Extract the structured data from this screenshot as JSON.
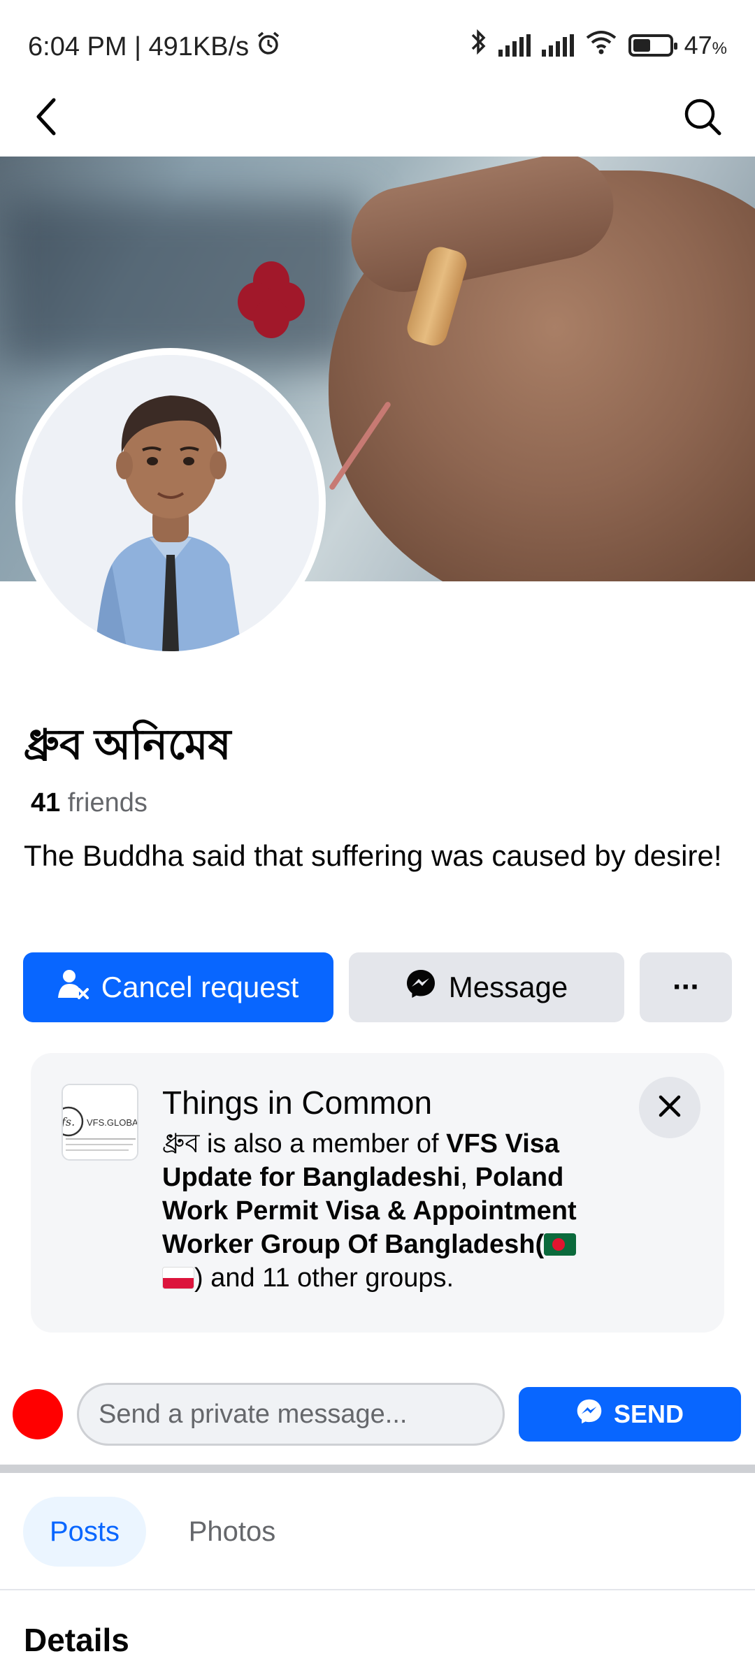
{
  "status_bar": {
    "time_speed": "6:04 PM | 491KB/s",
    "battery": "47",
    "battery_unit": "%",
    "battery_level": 0.47
  },
  "profile": {
    "name": "ধ্রুব অনিমেষ",
    "friends_count": "41",
    "friends_label": "friends",
    "bio": "The Buddha said that suffering was caused by desire!"
  },
  "actions": {
    "cancel_request_label": "Cancel request",
    "message_label": "Message",
    "more_label": "···"
  },
  "common": {
    "title": "Things in Common",
    "thumb_text": "VFS.GLOBAL",
    "prefix": "ধ্রুব is also a member of ",
    "group1": "VFS Visa Update for Bangladeshi",
    "sep": ", ",
    "group2": "Poland Work Permit Visa & Appointment Worker Group Of Bangladesh(",
    "suffix": ") and 11 other groups."
  },
  "private_message": {
    "placeholder": "Send a private message...",
    "send_label": "SEND"
  },
  "tabs": [
    {
      "label": "Posts",
      "active": true
    },
    {
      "label": "Photos",
      "active": false
    }
  ],
  "details": {
    "heading": "Details"
  },
  "colors": {
    "accent": "#0866ff",
    "secondary_bg": "#e4e6eb"
  },
  "icons": {
    "back": "back-arrow-icon",
    "search": "search-icon",
    "cancel_request": "person-x-icon",
    "message": "messenger-icon",
    "close": "close-icon"
  }
}
